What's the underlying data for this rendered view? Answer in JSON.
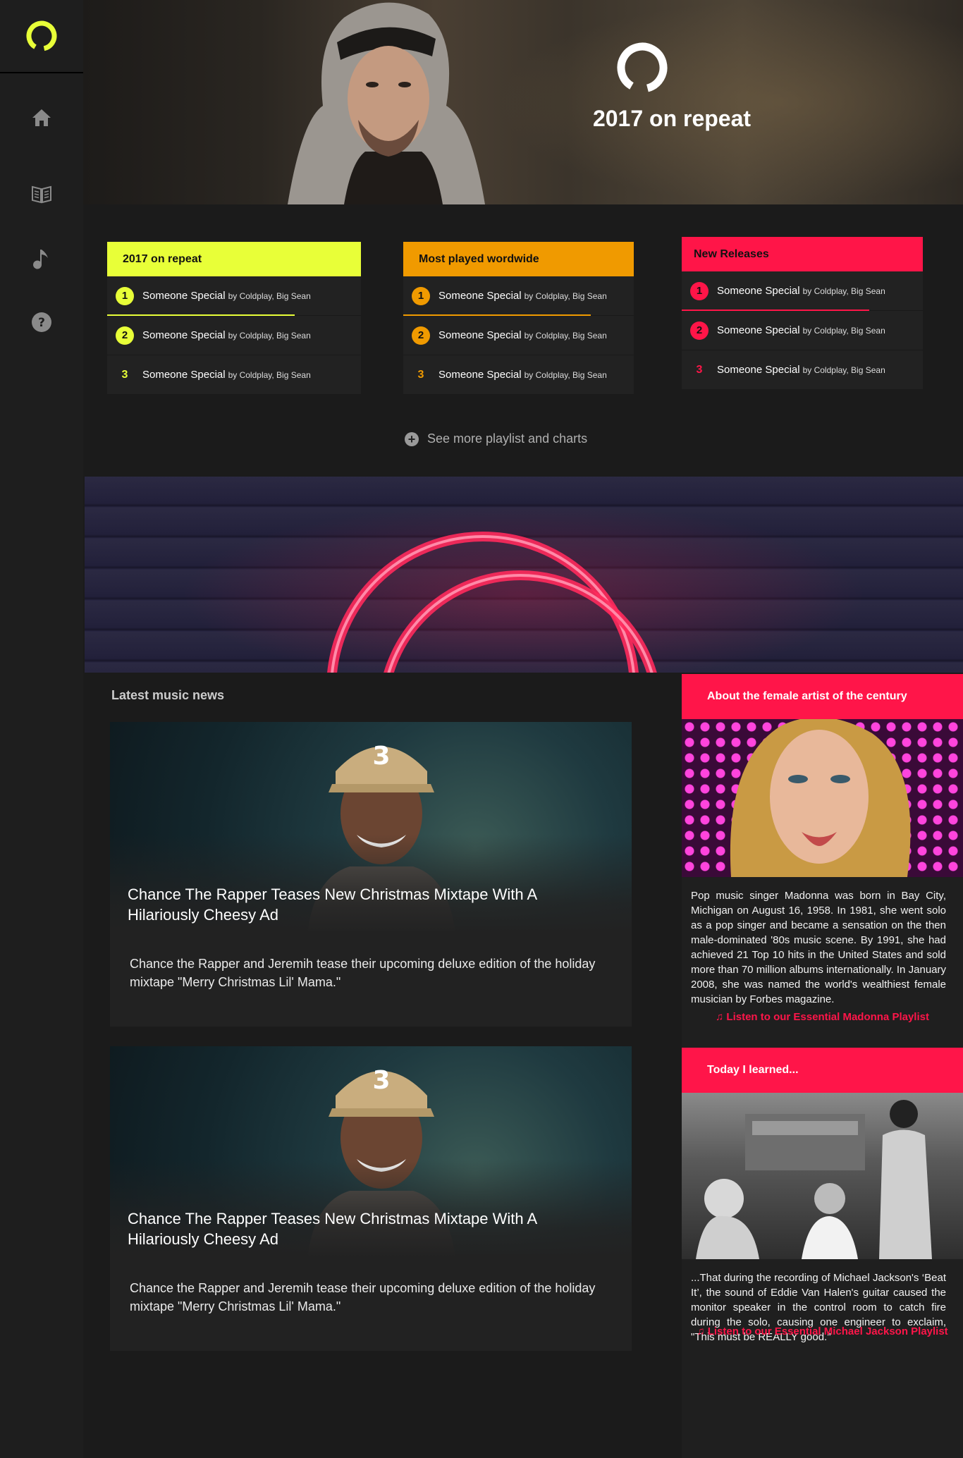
{
  "colors": {
    "yellow": "#e8ff38",
    "orange": "#f09a00",
    "pink": "#ff1549",
    "red": "#ff1548"
  },
  "hero": {
    "title": "2017 on repeat"
  },
  "sidebar": {
    "items": [
      "home-icon",
      "book-icon",
      "music-note-icon",
      "help-icon"
    ]
  },
  "charts": [
    {
      "title": "2017 on repeat",
      "rows": [
        {
          "rank": "1",
          "song": "Someone Special",
          "artists": "by Coldplay, Big Sean"
        },
        {
          "rank": "2",
          "song": "Someone Special",
          "artists": "by Coldplay, Big Sean"
        },
        {
          "rank": "3",
          "song": "Someone Special",
          "artists": "by Coldplay, Big Sean"
        }
      ]
    },
    {
      "title": "Most played wordwide",
      "rows": [
        {
          "rank": "1",
          "song": "Someone Special",
          "artists": "by Coldplay, Big Sean"
        },
        {
          "rank": "2",
          "song": "Someone Special",
          "artists": "by Coldplay, Big Sean"
        },
        {
          "rank": "3",
          "song": "Someone Special",
          "artists": "by Coldplay, Big Sean"
        }
      ]
    },
    {
      "title": "New Releases",
      "rows": [
        {
          "rank": "1",
          "song": "Someone Special",
          "artists": "by Coldplay, Big Sean"
        },
        {
          "rank": "2",
          "song": "Someone Special",
          "artists": "by Coldplay, Big Sean"
        },
        {
          "rank": "3",
          "song": "Someone Special",
          "artists": "by Coldplay, Big Sean"
        }
      ]
    }
  ],
  "see_more": {
    "label": "See more playlist  and charts"
  },
  "news": {
    "section_title": "Latest music news",
    "items": [
      {
        "headline": "Chance The Rapper Teases New Christmas Mixtape With A Hilariously Cheesy Ad",
        "description": "Chance the Rapper and Jeremih tease their upcoming deluxe edition of the holiday mixtape \"Merry Christmas Lil' Mama.\""
      },
      {
        "headline": "Chance The Rapper Teases New Christmas Mixtape With A Hilariously Cheesy Ad",
        "description": "Chance the Rapper and Jeremih tease their upcoming deluxe edition of the holiday mixtape \"Merry Christmas Lil' Mama.\""
      }
    ]
  },
  "about_artist": {
    "heading": "About the female artist of the century",
    "text": "Pop music singer Madonna was born in Bay City, Michigan on August 16, 1958. In 1981, she went solo as a pop singer and became a sensation on the then male-dominated '80s music scene. By 1991, she had achieved 21 Top 10 hits in the United States and sold more than 70 million albums internationally. In January 2008, she was named the world's wealthiest female musician by Forbes magazine.",
    "link": "♫ Listen to our Essential Madonna Playlist"
  },
  "til": {
    "heading": "Today I learned...",
    "text": "...That during the recording of Michael Jackson's ‘Beat It’, the sound of Eddie Van Halen's guitar caused the monitor speaker in the control room to catch fire during the solo, causing one engineer to exclaim, \"This must be REALLY good.\"",
    "link": "♫ Listen to our Essential Michael Jackson Playlist"
  }
}
